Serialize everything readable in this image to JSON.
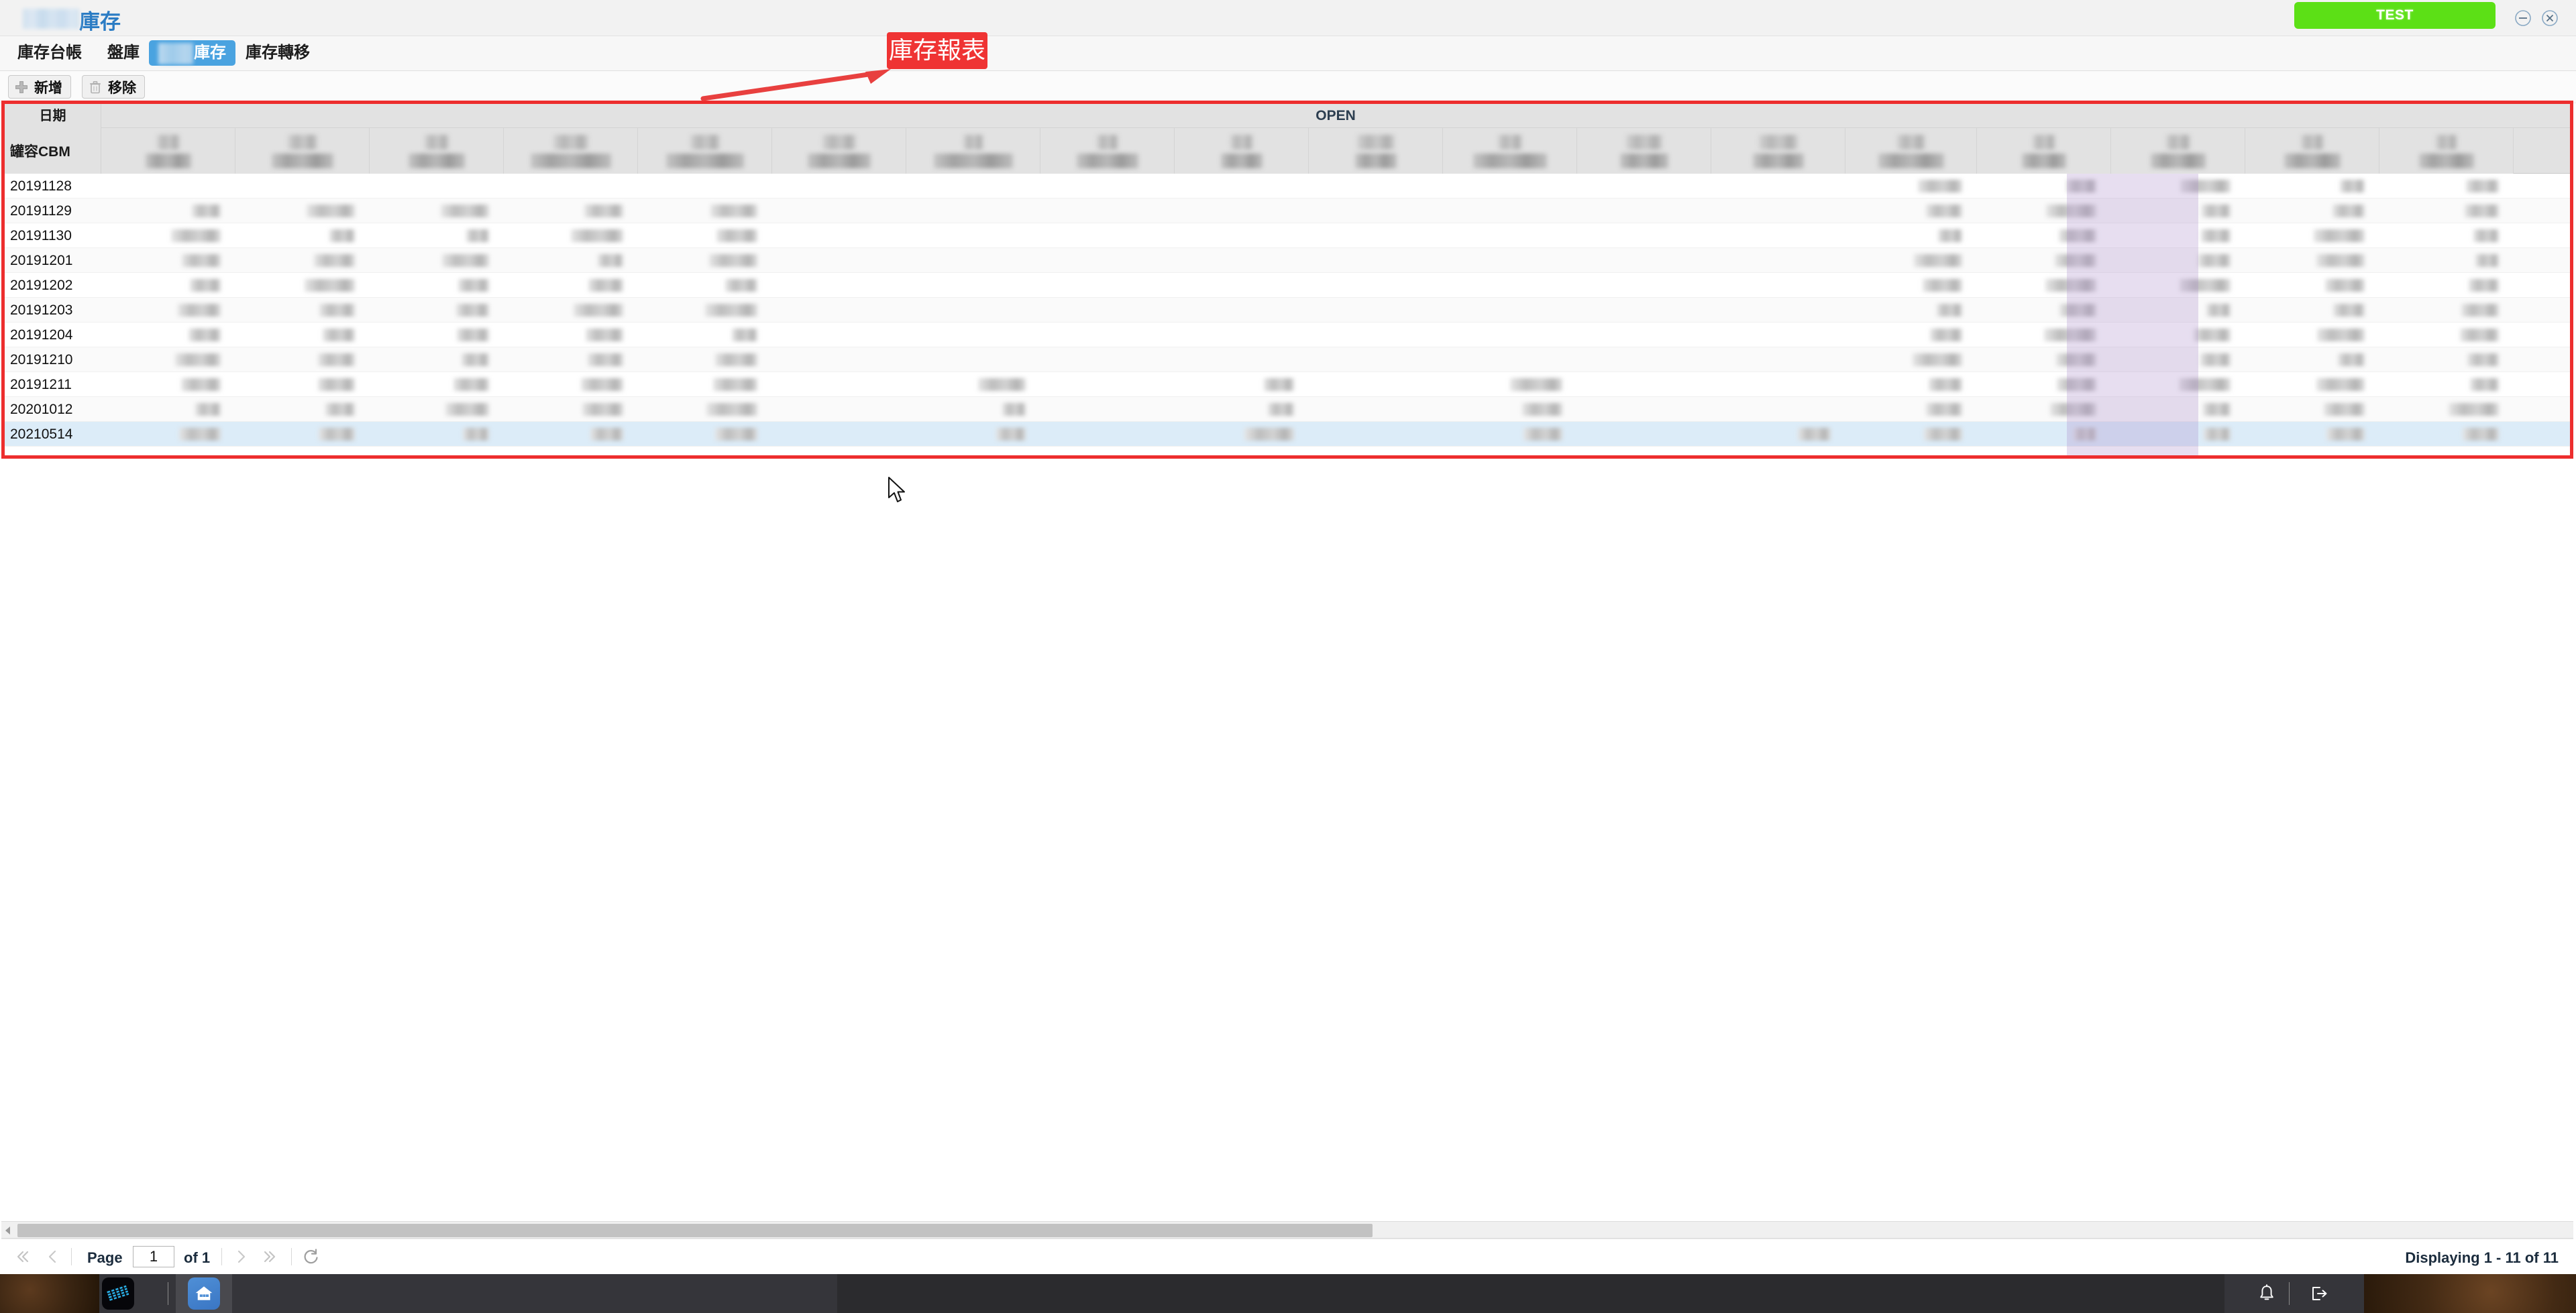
{
  "window": {
    "app_title_suffix": "庫存",
    "test_button_label": "TEST",
    "minimize_icon": "minimize-circle-icon",
    "close_icon": "close-circle-icon"
  },
  "tabs": [
    {
      "label": "庫存台帳",
      "active": false,
      "blurred_prefix": false
    },
    {
      "label": "盤庫",
      "active": false,
      "blurred_prefix": false
    },
    {
      "label": "庫存",
      "active": true,
      "blurred_prefix": true
    },
    {
      "label": "庫存轉移",
      "active": false,
      "blurred_prefix": false
    }
  ],
  "toolbar": {
    "add_label": "新增",
    "add_icon": "plus-icon",
    "remove_label": "移除",
    "remove_icon": "trash-icon"
  },
  "annotation": {
    "label": "庫存報表",
    "color": "#ef3333",
    "arrow_icon": "arrow-right-icon"
  },
  "grid": {
    "frame_color": "#ed2e2e",
    "group_header": "OPEN",
    "locked_header_top": "日期",
    "locked_header_bottom": "罐容CBM",
    "highlight_column_color": "#a889ca",
    "selected_row_color": "#dcecf8",
    "column_count": 18,
    "columns": [
      {
        "redacted": true
      },
      {
        "redacted": true
      },
      {
        "redacted": true
      },
      {
        "redacted": true
      },
      {
        "redacted": true
      },
      {
        "redacted": true
      },
      {
        "redacted": true
      },
      {
        "redacted": true
      },
      {
        "redacted": true
      },
      {
        "redacted": true
      },
      {
        "redacted": true
      },
      {
        "redacted": true
      },
      {
        "redacted": true
      },
      {
        "redacted": true
      },
      {
        "redacted": true
      },
      {
        "redacted": true
      },
      {
        "redacted": true
      },
      {
        "redacted": true
      }
    ],
    "rows": [
      {
        "date": "20191128",
        "selected": false
      },
      {
        "date": "20191129",
        "selected": false
      },
      {
        "date": "20191130",
        "selected": false
      },
      {
        "date": "20191201",
        "selected": false
      },
      {
        "date": "20191202",
        "selected": false
      },
      {
        "date": "20191203",
        "selected": false
      },
      {
        "date": "20191204",
        "selected": false
      },
      {
        "date": "20191210",
        "selected": false
      },
      {
        "date": "20191211",
        "selected": false
      },
      {
        "date": "20201012",
        "selected": false
      },
      {
        "date": "20210514",
        "selected": true
      }
    ]
  },
  "pager": {
    "first_icon": "double-chevron-left-icon",
    "prev_icon": "chevron-left-icon",
    "page_label": "Page",
    "page_value": "1",
    "of_label": "of 1",
    "next_icon": "chevron-right-icon",
    "last_icon": "double-chevron-right-icon",
    "refresh_icon": "refresh-icon",
    "status": "Displaying 1 - 11 of 11"
  },
  "taskbar": {
    "app_icon": "ibm-app-icon",
    "home_icon": "home-icon",
    "notification_icon": "bell-icon",
    "logout_icon": "logout-icon"
  },
  "cursor": {
    "icon": "mouse-pointer-icon"
  }
}
